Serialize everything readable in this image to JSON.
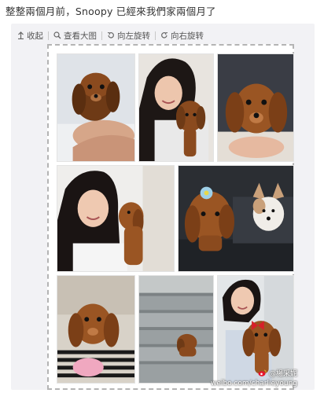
{
  "post": {
    "text": "整整兩個月前，Snoopy 已經來我們家兩個月了"
  },
  "toolbar": {
    "collapse_label": "收起",
    "view_large_label": "查看大图",
    "rotate_left_label": "向左旋转",
    "rotate_right_label": "向右旋转"
  },
  "watermark": {
    "handle": "@楊采妮",
    "url": "weibo.com/charlieyoung"
  },
  "colors": {
    "card_bg": "#f2f2f5",
    "frame_border": "#b4b4b4",
    "dachshund_brown": "#8a4a1e",
    "toolbar_text": "#555555"
  },
  "photos": [
    {
      "id": 1,
      "subject": "puppy held in hand on white bed"
    },
    {
      "id": 2,
      "subject": "smiling woman holding puppy"
    },
    {
      "id": 3,
      "subject": "puppy close-up held up"
    },
    {
      "id": 4,
      "subject": "woman kissing puppy"
    },
    {
      "id": 5,
      "subject": "puppy with blue flower and corgi in car"
    },
    {
      "id": 6,
      "subject": "puppy on lap with striped shirt"
    },
    {
      "id": 7,
      "subject": "puppy on stairs"
    },
    {
      "id": 8,
      "subject": "woman holding puppy with red bow"
    }
  ]
}
